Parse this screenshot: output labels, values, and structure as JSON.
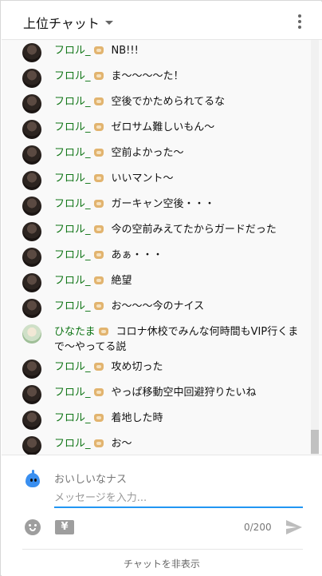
{
  "header": {
    "title": "上位チャット"
  },
  "chat": {
    "messages": [
      {
        "author": "フロル_",
        "text": "NB!!!",
        "avatar": "user-avatar"
      },
      {
        "author": "フロル_",
        "text": "ま～～～～た！",
        "avatar": "user-avatar"
      },
      {
        "author": "フロル_",
        "text": "空後でかためられてるな",
        "avatar": "user-avatar"
      },
      {
        "author": "フロル_",
        "text": "ゼロサム難しいもん～",
        "avatar": "user-avatar"
      },
      {
        "author": "フロル_",
        "text": "空前よかった～",
        "avatar": "user-avatar"
      },
      {
        "author": "フロル_",
        "text": "いいマント～",
        "avatar": "user-avatar"
      },
      {
        "author": "フロル_",
        "text": "ガーキャン空後・・・",
        "avatar": "user-avatar"
      },
      {
        "author": "フロル_",
        "text": "今の空前みえてたからガードだった",
        "avatar": "user-avatar"
      },
      {
        "author": "フロル_",
        "text": "あぁ・・・",
        "avatar": "user-avatar"
      },
      {
        "author": "フロル_",
        "text": "絶望",
        "avatar": "user-avatar"
      },
      {
        "author": "フロル_",
        "text": "お～～～今のナイス",
        "avatar": "user-avatar"
      },
      {
        "author": "ひなたま",
        "text": "コロナ休校でみんな何時間もVIP行くまで～やってる説",
        "avatar": "user-avatar-alt"
      },
      {
        "author": "フロル_",
        "text": "攻め切った",
        "avatar": "user-avatar"
      },
      {
        "author": "フロル_",
        "text": "やっぱ移動空中回避狩りたいね",
        "avatar": "user-avatar"
      },
      {
        "author": "フロル_",
        "text": "着地した時",
        "avatar": "user-avatar"
      },
      {
        "author": "フロル_",
        "text": "お～",
        "avatar": "user-avatar"
      }
    ]
  },
  "composer": {
    "username": "おいしいなナス",
    "placeholder": "メッセージを入力...",
    "counter": "0/200",
    "yen_label": "¥"
  },
  "footer": {
    "hide_chat_label": "チャットを非表示"
  },
  "colors": {
    "author": "#107516",
    "accent": "#2196f3"
  }
}
